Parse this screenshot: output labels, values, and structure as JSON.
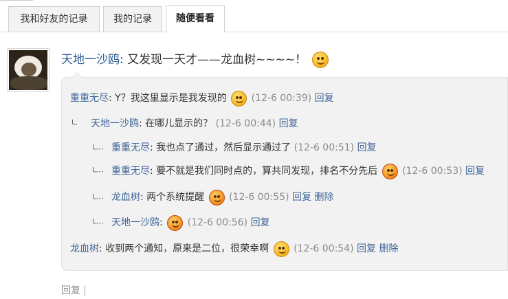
{
  "tabs": [
    {
      "label": "我和好友的记录",
      "active": false
    },
    {
      "label": "我的记录",
      "active": false
    },
    {
      "label": "随便看看",
      "active": true
    }
  ],
  "post": {
    "author": "天地一沙鸥",
    "text": ": 又发现一天才——龙血树~~~~！",
    "emoji": "surprised-smiley-icon"
  },
  "comments": [
    {
      "author": "重重无尽",
      "text": ": Y？我这里显示是我发现的",
      "emoji": "thinking-smiley-icon",
      "time": "(12-6 00:39)",
      "actions": [
        "回复"
      ]
    },
    {
      "author": "天地一沙鸥",
      "text": ": 在哪儿显示的？",
      "emoji": "",
      "time": "(12-6 00:44)",
      "actions": [
        "回复"
      ]
    },
    {
      "author": "重重无尽",
      "text": ": 我也点了通过，然后显示通过了",
      "emoji": "",
      "time": "(12-6 00:51)",
      "actions": [
        "回复"
      ]
    },
    {
      "author": "重重无尽",
      "text": ": 要不就是我们同时点的，算共同发现，排名不分先后",
      "emoji": "tongue-smiley-icon",
      "time": "(12-6 00:53)",
      "actions": [
        "回复"
      ]
    },
    {
      "author": "龙血树",
      "text": ": 两个系统提醒",
      "emoji": "grin-smiley-icon",
      "time": "(12-6 00:55)",
      "actions": [
        "回复",
        "删除"
      ]
    },
    {
      "author": "天地一沙鸥",
      "text": ": ",
      "emoji": "crying-smiley-icon",
      "time": "(12-6 00:56)",
      "actions": [
        "回复"
      ]
    },
    {
      "author": "龙血树",
      "text": ": 收到两个通知，原来是二位，很荣幸啊",
      "emoji": "laugh-smiley-icon",
      "time": "(12-6 00:54)",
      "actions": [
        "回复",
        "删除"
      ]
    }
  ],
  "footer": {
    "reply_label": "回复",
    "separator": "|"
  }
}
